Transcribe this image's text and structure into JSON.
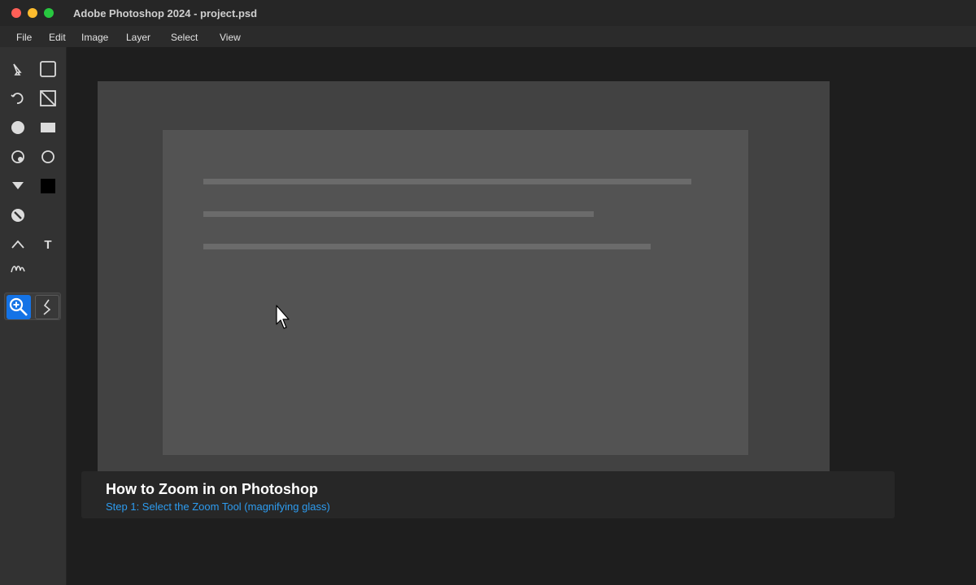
{
  "window": {
    "title": "Adobe Photoshop 2024 - project.psd"
  },
  "menu": {
    "items": [
      "File",
      "Edit",
      "Image",
      "Layer",
      "Select",
      "View"
    ]
  },
  "toolbar": {
    "tools": [
      {
        "icon": "move-icon"
      },
      {
        "icon": "rectangle-select-icon"
      },
      {
        "icon": "lasso-icon"
      },
      {
        "icon": "crop-icon"
      },
      {
        "icon": "brush-icon"
      },
      {
        "icon": "shape-rect-icon"
      },
      {
        "icon": "quick-select-icon"
      },
      {
        "icon": "ellipse-icon"
      },
      {
        "icon": "gradient-icon"
      },
      {
        "icon": "foreground-color-icon"
      },
      {
        "icon": "eraser-icon"
      },
      {
        "icon": "pen-icon"
      },
      {
        "icon": "type-icon"
      },
      {
        "icon": "smudge-icon"
      },
      {
        "icon": "zoom-icon",
        "active": true
      },
      {
        "icon": "hand-icon"
      }
    ],
    "type_label": "T",
    "active_color": "#1473e6"
  },
  "caption": {
    "title": "How to Zoom in on Photoshop",
    "step": "Step 1: Select the Zoom Tool (magnifying glass)",
    "step_color": "#2d9cf0"
  }
}
